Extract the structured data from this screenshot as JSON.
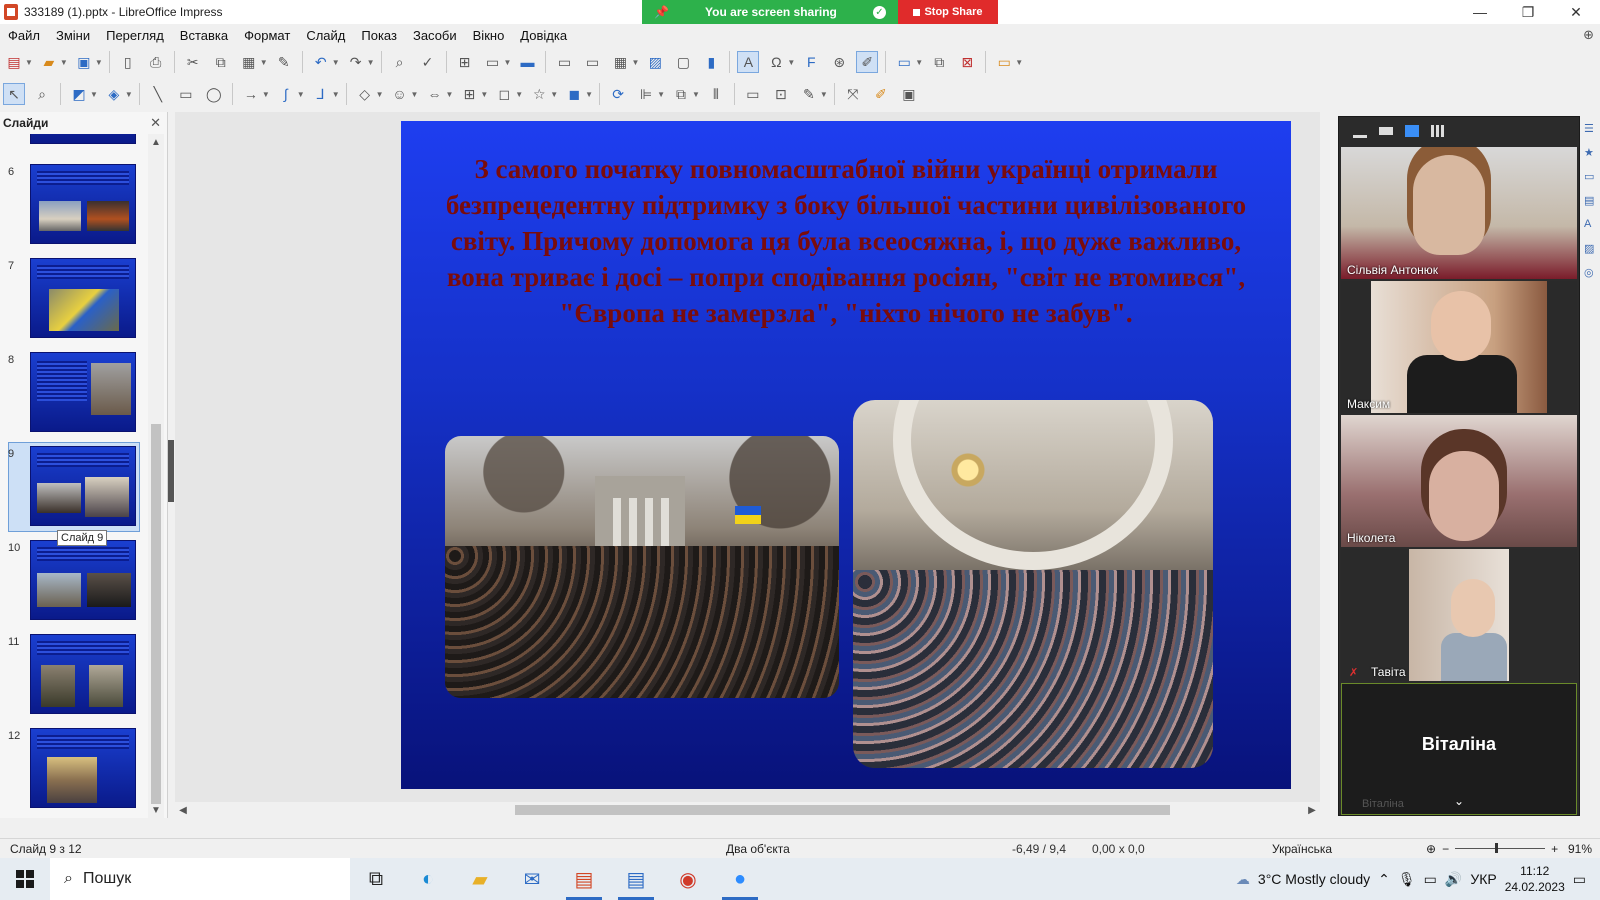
{
  "window": {
    "title": "333189 (1).pptx - LibreOffice Impress",
    "controls": [
      "—",
      "❐",
      "✕"
    ]
  },
  "screen_share": {
    "status": "You are screen sharing",
    "stop_label": "Stop Share"
  },
  "menu": [
    "Файл",
    "Зміни",
    "Перегляд",
    "Вставка",
    "Формат",
    "Слайд",
    "Показ",
    "Засоби",
    "Вікно",
    "Довідка"
  ],
  "slides_panel": {
    "title": "Слайди",
    "tooltip": "Слайд 9",
    "thumbnails": [
      {
        "num": "6"
      },
      {
        "num": "7"
      },
      {
        "num": "8"
      },
      {
        "num": "9"
      },
      {
        "num": "10"
      },
      {
        "num": "11"
      },
      {
        "num": "12"
      }
    ],
    "selected": "9"
  },
  "slide": {
    "text": "З самого початку повномасштабної війни українці отримали безпрецедентну підтримку з боку більшої частини цивілізованого світу. Причому допомога ця була всеосяжна, і, що дуже важливо, вона триває і досі – попри сподівання росіян, \"світ не втомився\", \"Європа не замерзла\", \"ніхто нічого не забув\".",
    "colors": {
      "bg_top": "#1e3ef0",
      "bg_bottom": "#08127a",
      "text": "#7a0c0c"
    }
  },
  "participants": [
    {
      "name": "Сільвія Антонюк"
    },
    {
      "name": "Максим"
    },
    {
      "name": "Ніколета"
    },
    {
      "name": "Тавіта"
    },
    {
      "name": "Віталіна",
      "small": "Віталіна"
    }
  ],
  "statusbar": {
    "slide": "Слайд 9 з 12",
    "selection": "Два об'єкта",
    "position": "-6,49 / 9,4",
    "size": "0,00 x 0,0",
    "language": "Українська",
    "zoom": "91%"
  },
  "taskbar": {
    "search_placeholder": "Пошук",
    "weather": "3°C  Mostly cloudy",
    "keyboard": "УКР",
    "time": "11:12",
    "date": "24.02.2023"
  }
}
